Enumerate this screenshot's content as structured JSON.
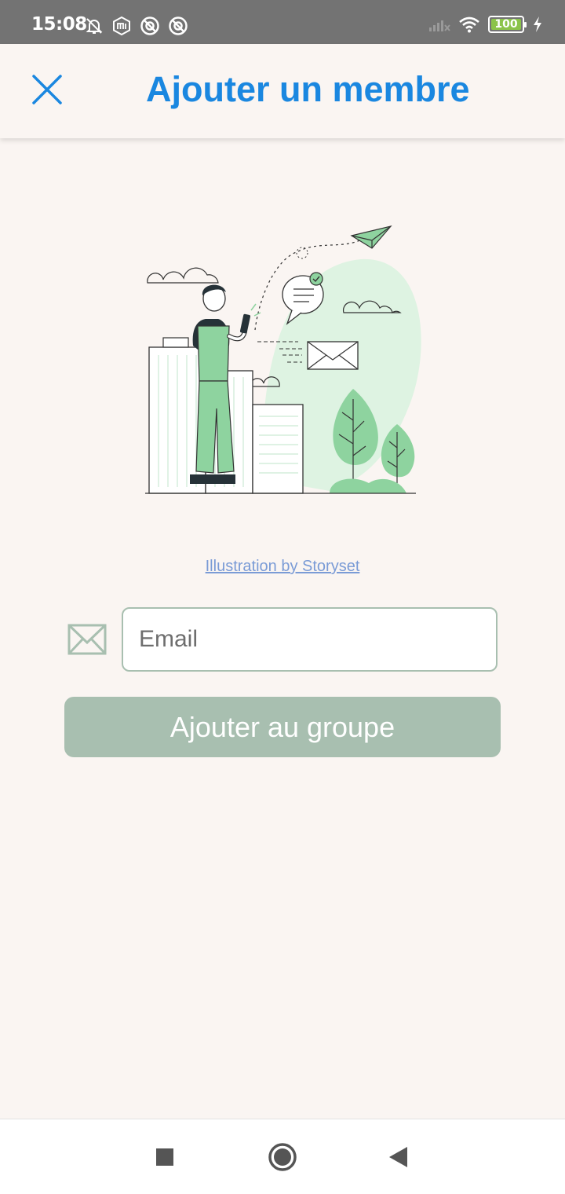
{
  "status_bar": {
    "time": "15:08",
    "left_icons": [
      "notifications-off-icon",
      "mi-icon",
      "app-icon",
      "app-icon"
    ],
    "right_icons": [
      "signal-icon",
      "wifi-icon",
      "battery-icon",
      "charging-icon"
    ],
    "battery_level": "100",
    "battery_color": "#8bc34a"
  },
  "header": {
    "title": "Ajouter un membre",
    "close_icon": "close-icon",
    "accent_color": "#1a87e0"
  },
  "illustration": {
    "credit": "Illustration by Storyset"
  },
  "form": {
    "email_icon": "envelope-icon",
    "email_placeholder": "Email",
    "email_value": "",
    "submit_label": "Ajouter au groupe",
    "button_color": "#a8bfb0"
  },
  "nav_bar": {
    "buttons": [
      "recents-icon",
      "home-icon",
      "back-icon"
    ]
  }
}
